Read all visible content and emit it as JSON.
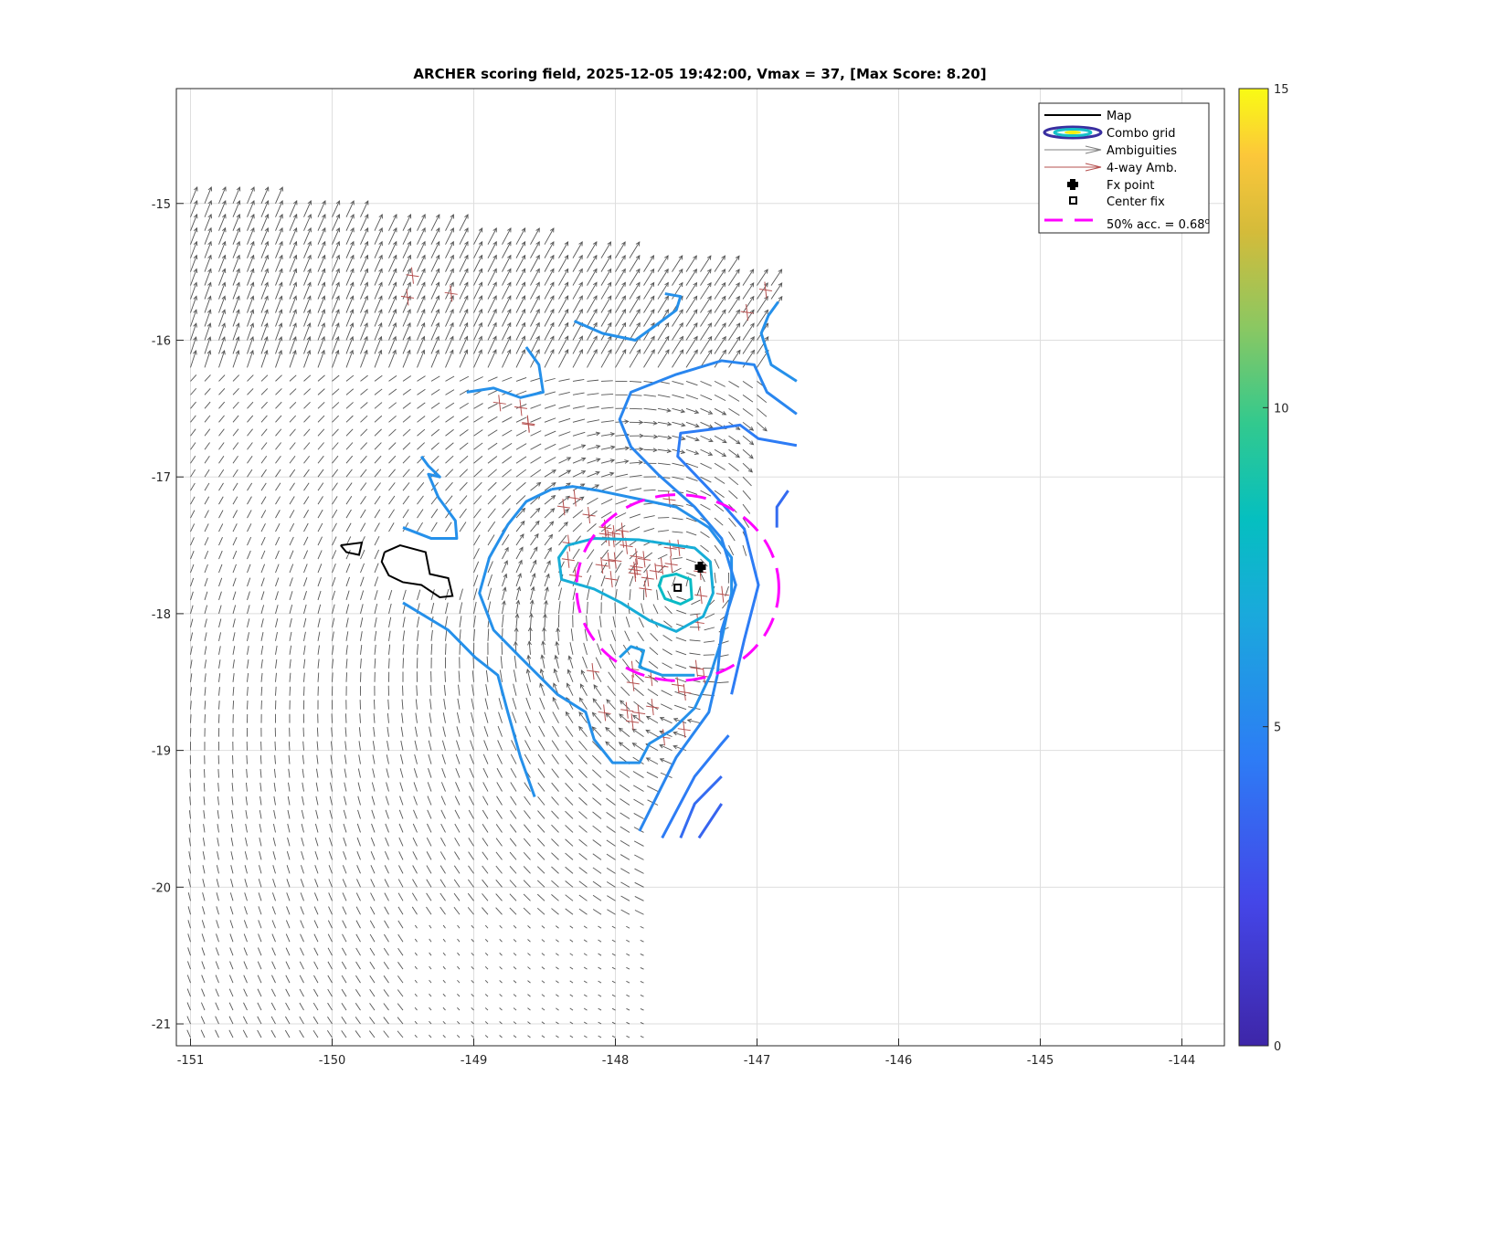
{
  "chart_data": {
    "type": "contour",
    "title": "ARCHER scoring field, 2025-12-05 19:42:00, Vmax = 37, [Max Score: 8.20]",
    "xlabel": "",
    "ylabel": "",
    "xlim": [
      -151.1,
      -143.7
    ],
    "ylim": [
      -21.16,
      -14.16
    ],
    "xticks": [
      -151,
      -150,
      -149,
      -148,
      -147,
      -146,
      -145,
      -144
    ],
    "yticks": [
      -15,
      -16,
      -17,
      -18,
      -19,
      -20,
      -21
    ],
    "grid": true,
    "colorbar": {
      "min": 0,
      "max": 15,
      "ticks": [
        0,
        5,
        10,
        15
      ],
      "colormap": "parula"
    },
    "legend": {
      "placement": "top-right",
      "entries": [
        "Map",
        "Combo grid",
        "Ambiguities",
        "4-way Amb.",
        "Fx point",
        "Center fix",
        "50% acc. = 0.68"
      ],
      "acc_superscript": "o"
    },
    "fx_point": {
      "lon": -147.4,
      "lat": -17.66
    },
    "center_fix": {
      "lon": -147.56,
      "lat": -17.81
    },
    "accuracy_circle": {
      "radius_deg": 0.68,
      "lon": -147.56,
      "lat": -17.81,
      "color": "#ff00ff"
    },
    "land": [
      [
        [
          -149.94,
          -17.5
        ],
        [
          -149.79,
          -17.48
        ],
        [
          -149.81,
          -17.57
        ],
        [
          -149.9,
          -17.55
        ],
        [
          -149.94,
          -17.5
        ]
      ],
      [
        [
          -149.63,
          -17.55
        ],
        [
          -149.52,
          -17.5
        ],
        [
          -149.34,
          -17.55
        ],
        [
          -149.31,
          -17.71
        ],
        [
          -149.18,
          -17.74
        ],
        [
          -149.15,
          -17.87
        ],
        [
          -149.24,
          -17.88
        ],
        [
          -149.37,
          -17.79
        ],
        [
          -149.5,
          -17.77
        ],
        [
          -149.6,
          -17.72
        ],
        [
          -149.65,
          -17.62
        ],
        [
          -149.63,
          -17.55
        ]
      ]
    ],
    "contours": [
      {
        "level": 5.5,
        "points": [
          [
            -148.45,
            -17.09
          ],
          [
            -148.3,
            -17.07
          ],
          [
            -148.12,
            -17.1
          ],
          [
            -147.89,
            -17.15
          ],
          [
            -147.57,
            -17.22
          ],
          [
            -147.34,
            -17.37
          ],
          [
            -147.18,
            -17.59
          ],
          [
            -147.18,
            -17.85
          ],
          [
            -147.25,
            -18.19
          ],
          [
            -147.33,
            -18.45
          ],
          [
            -147.44,
            -18.69
          ],
          [
            -147.6,
            -18.85
          ],
          [
            -147.76,
            -18.95
          ],
          [
            -147.83,
            -19.09
          ],
          [
            -148.02,
            -19.09
          ],
          [
            -148.15,
            -18.92
          ],
          [
            -148.21,
            -18.72
          ],
          [
            -148.41,
            -18.59
          ],
          [
            -148.67,
            -18.32
          ],
          [
            -148.86,
            -18.12
          ],
          [
            -148.96,
            -17.85
          ],
          [
            -148.89,
            -17.59
          ],
          [
            -148.76,
            -17.35
          ],
          [
            -148.63,
            -17.18
          ],
          [
            -148.45,
            -17.09
          ]
        ]
      },
      {
        "level": 7,
        "points": [
          [
            -148.34,
            -17.5
          ],
          [
            -148.15,
            -17.45
          ],
          [
            -147.83,
            -17.46
          ],
          [
            -147.44,
            -17.52
          ],
          [
            -147.33,
            -17.62
          ],
          [
            -147.31,
            -17.85
          ],
          [
            -147.38,
            -18.02
          ],
          [
            -147.57,
            -18.13
          ],
          [
            -147.76,
            -18.05
          ],
          [
            -147.96,
            -17.92
          ],
          [
            -148.15,
            -17.82
          ],
          [
            -148.38,
            -17.75
          ],
          [
            -148.4,
            -17.59
          ],
          [
            -148.34,
            -17.5
          ]
        ]
      },
      {
        "level": 8,
        "points": [
          [
            -147.67,
            -17.73
          ],
          [
            -147.57,
            -17.71
          ],
          [
            -147.47,
            -17.75
          ],
          [
            -147.46,
            -17.89
          ],
          [
            -147.54,
            -17.93
          ],
          [
            -147.65,
            -17.89
          ],
          [
            -147.69,
            -17.8
          ],
          [
            -147.67,
            -17.73
          ]
        ]
      },
      {
        "level": 6,
        "points": [
          [
            -147.97,
            -18.32
          ],
          [
            -147.89,
            -18.24
          ],
          [
            -147.8,
            -18.27
          ],
          [
            -147.83,
            -18.39
          ],
          [
            -147.67,
            -18.45
          ],
          [
            -147.44,
            -18.45
          ]
        ]
      },
      {
        "level": 5.5,
        "points": [
          [
            -148.29,
            -15.86
          ],
          [
            -148.09,
            -15.95
          ],
          [
            -147.86,
            -16.0
          ],
          [
            -147.7,
            -15.88
          ],
          [
            -147.57,
            -15.78
          ],
          [
            -147.54,
            -15.68
          ],
          [
            -147.65,
            -15.66
          ]
        ]
      },
      {
        "level": 5.5,
        "points": [
          [
            -146.72,
            -16.3
          ],
          [
            -146.9,
            -16.18
          ],
          [
            -146.97,
            -15.95
          ],
          [
            -146.92,
            -15.82
          ],
          [
            -146.85,
            -15.72
          ]
        ]
      },
      {
        "level": 5,
        "points": [
          [
            -146.72,
            -16.54
          ],
          [
            -146.93,
            -16.38
          ],
          [
            -147.02,
            -16.18
          ],
          [
            -147.25,
            -16.15
          ],
          [
            -147.57,
            -16.25
          ],
          [
            -147.89,
            -16.38
          ],
          [
            -147.97,
            -16.58
          ],
          [
            -147.89,
            -16.78
          ],
          [
            -147.7,
            -16.98
          ],
          [
            -147.44,
            -17.22
          ],
          [
            -147.25,
            -17.45
          ],
          [
            -147.15,
            -17.79
          ],
          [
            -147.25,
            -18.12
          ],
          [
            -147.28,
            -18.45
          ],
          [
            -147.34,
            -18.72
          ],
          [
            -147.57,
            -19.05
          ],
          [
            -147.83,
            -19.59
          ]
        ]
      },
      {
        "level": 4.5,
        "points": [
          [
            -146.72,
            -16.77
          ],
          [
            -146.99,
            -16.72
          ],
          [
            -147.12,
            -16.62
          ],
          [
            -147.31,
            -16.65
          ],
          [
            -147.54,
            -16.68
          ],
          [
            -147.56,
            -16.85
          ],
          [
            -147.31,
            -17.12
          ],
          [
            -147.09,
            -17.38
          ],
          [
            -146.99,
            -17.79
          ],
          [
            -147.09,
            -18.19
          ],
          [
            -147.18,
            -18.59
          ]
        ]
      },
      {
        "level": 4.5,
        "points": [
          [
            -147.2,
            -18.89
          ],
          [
            -147.25,
            -18.95
          ],
          [
            -147.44,
            -19.19
          ],
          [
            -147.67,
            -19.64
          ]
        ]
      },
      {
        "level": 3.8,
        "points": [
          [
            -146.78,
            -17.1
          ],
          [
            -146.86,
            -17.22
          ],
          [
            -146.86,
            -17.37
          ]
        ]
      },
      {
        "level": 3.8,
        "points": [
          [
            -147.25,
            -19.19
          ],
          [
            -147.44,
            -19.39
          ],
          [
            -147.54,
            -19.64
          ]
        ]
      },
      {
        "level": 3.5,
        "points": [
          [
            -147.25,
            -19.39
          ],
          [
            -147.41,
            -19.64
          ]
        ]
      },
      {
        "level": 5.5,
        "points": [
          [
            -149.05,
            -16.38
          ],
          [
            -148.86,
            -16.35
          ],
          [
            -148.67,
            -16.42
          ],
          [
            -148.51,
            -16.38
          ],
          [
            -148.54,
            -16.18
          ],
          [
            -148.63,
            -16.05
          ]
        ]
      },
      {
        "level": 5.5,
        "points": [
          [
            -149.5,
            -17.37
          ],
          [
            -149.3,
            -17.45
          ],
          [
            -149.12,
            -17.45
          ],
          [
            -149.13,
            -17.32
          ],
          [
            -149.25,
            -17.15
          ],
          [
            -149.32,
            -16.98
          ],
          [
            -149.24,
            -17.0
          ],
          [
            -149.32,
            -16.92
          ],
          [
            -149.37,
            -16.85
          ]
        ]
      },
      {
        "level": 5.5,
        "points": [
          [
            -149.5,
            -17.92
          ],
          [
            -149.18,
            -18.12
          ],
          [
            -148.99,
            -18.32
          ],
          [
            -148.83,
            -18.45
          ],
          [
            -148.76,
            -18.72
          ],
          [
            -148.67,
            -19.05
          ],
          [
            -148.57,
            -19.34
          ]
        ]
      }
    ],
    "wind_field": {
      "vortex_lon": -147.5,
      "vortex_lat": -17.8,
      "spacing_deg": 0.1,
      "color": "#555555"
    },
    "four_way_clusters": [
      {
        "lon": -148.0,
        "lat": -17.45,
        "n": 18
      },
      {
        "lon": -147.75,
        "lat": -17.6,
        "n": 14
      },
      {
        "lon": -147.7,
        "lat": -18.65,
        "n": 14
      },
      {
        "lon": -148.65,
        "lat": -16.6,
        "n": 4
      },
      {
        "lon": -149.3,
        "lat": -15.6,
        "n": 3
      },
      {
        "lon": -148.2,
        "lat": -18.45,
        "n": 1
      },
      {
        "lon": -147.3,
        "lat": -17.95,
        "n": 3
      },
      {
        "lon": -146.95,
        "lat": -15.7,
        "n": 2
      }
    ]
  }
}
